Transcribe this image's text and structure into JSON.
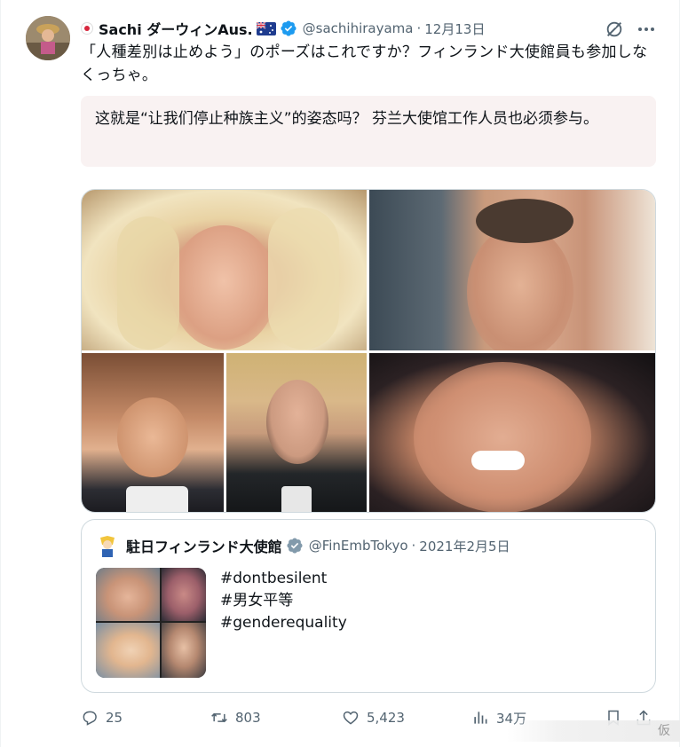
{
  "tweet": {
    "display_name": "Sachi ダーウィンAus.",
    "handle": "@sachihirayama",
    "separator": "·",
    "timestamp": "12月13日",
    "text": "「人種差別は止めよう」のポーズはこれですか？フィンランド大使館員も参加しなくっちゃ。",
    "translation": "这就是“让我们停止种族主义”的姿态吗？ 芬兰大使馆工作人员也必须参与。"
  },
  "quote": {
    "display_name": "駐日フィンランド大使館",
    "handle": "@FinEmbTokyo",
    "separator": "·",
    "timestamp": "2021年2月5日",
    "lines": [
      "#dontbesilent",
      "#男女平等",
      "#genderequality"
    ]
  },
  "actions": {
    "replies": "25",
    "retweets": "803",
    "likes": "5,423",
    "views": "34万"
  },
  "watermark": "仮",
  "colors": {
    "verified": "#1d9bf0",
    "secondary_text": "#536471",
    "translation_bg": "#f9f2f2",
    "border": "#cfd9de"
  },
  "icons": [
    "grok-icon",
    "more-icon",
    "verified-badge-icon",
    "reply-icon",
    "retweet-icon",
    "like-icon",
    "views-icon",
    "bookmark-icon",
    "share-icon"
  ]
}
